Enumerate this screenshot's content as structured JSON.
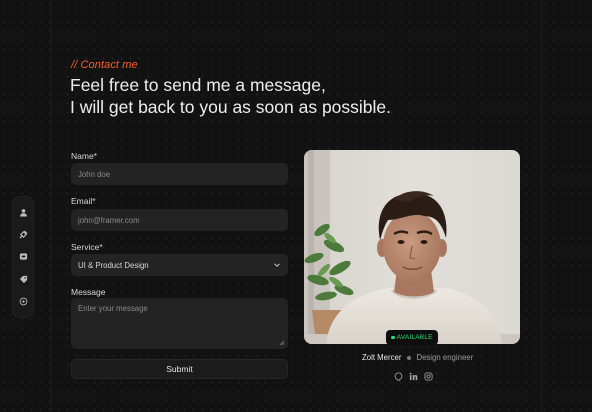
{
  "header": {
    "tag": "// Contact me",
    "line1": "Feel free to send me a message,",
    "line2": "I will get back to you as soon as possible."
  },
  "rail": {
    "items": [
      {
        "icon": "user-icon"
      },
      {
        "icon": "pen-tool-icon"
      },
      {
        "icon": "image-icon"
      },
      {
        "icon": "tag-icon"
      },
      {
        "icon": "settings-icon"
      }
    ]
  },
  "form": {
    "name_label": "Name*",
    "name_placeholder": "John doe",
    "email_label": "Email*",
    "email_placeholder": "john@framer.com",
    "service_label": "Service*",
    "service_value": "UI & Product Design",
    "message_label": "Message",
    "message_placeholder": "Enter your message",
    "submit_label": "Submit"
  },
  "profile": {
    "badge": "AVAILABLE",
    "name": "Zolt Mercer",
    "role": "Design engineer",
    "socials": [
      "github-icon",
      "linkedin-icon",
      "instagram-icon"
    ]
  },
  "colors": {
    "accent": "#ff5d2e",
    "available": "#2ddf74",
    "background": "#121212"
  }
}
